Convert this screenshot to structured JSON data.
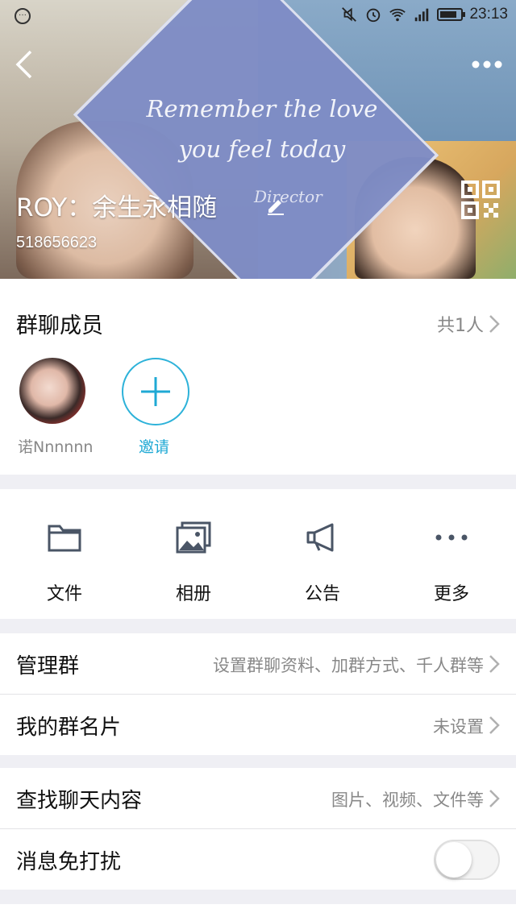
{
  "status_bar": {
    "time": "23:13",
    "icons": [
      "chat-notification-icon",
      "mute-icon",
      "alarm-icon",
      "wifi-icon",
      "signal-icon",
      "battery-icon"
    ]
  },
  "header": {
    "banner_text": [
      "Remember the love",
      "you feel today"
    ],
    "banner_watermark": "Director",
    "group_name": "ROY：余生永相随",
    "group_id": "518656623"
  },
  "members": {
    "title": "群聊成员",
    "count": "共1人",
    "items": [
      {
        "name": "诺Nnnnnn"
      }
    ],
    "invite_label": "邀请"
  },
  "tools": [
    {
      "label": "文件",
      "icon": "folder-icon"
    },
    {
      "label": "相册",
      "icon": "album-icon"
    },
    {
      "label": "公告",
      "icon": "megaphone-icon"
    },
    {
      "label": "更多",
      "icon": "more-dots-icon"
    }
  ],
  "rows": {
    "manage": {
      "label": "管理群",
      "value": "设置群聊资料、加群方式、千人群等"
    },
    "card": {
      "label": "我的群名片",
      "value": "未设置"
    },
    "search": {
      "label": "查找聊天内容",
      "value": "图片、视频、文件等"
    },
    "dnd": {
      "label": "消息免打扰",
      "enabled": false
    }
  },
  "colors": {
    "accent": "#1fa9d4",
    "background": "#efeff4"
  }
}
